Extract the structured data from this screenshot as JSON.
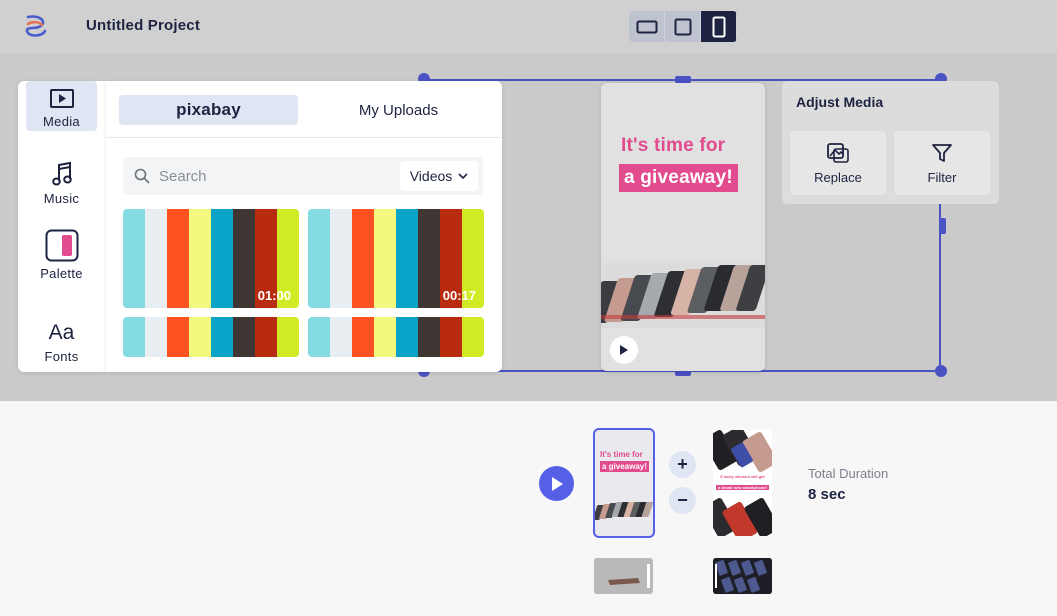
{
  "header": {
    "project_title": "Untitled Project",
    "aspect_options": [
      {
        "name": "landscape",
        "active": false
      },
      {
        "name": "square",
        "active": false
      },
      {
        "name": "portrait",
        "active": true
      }
    ]
  },
  "sidebar": {
    "items": [
      {
        "label": "Media",
        "icon": "media-icon",
        "active": true
      },
      {
        "label": "Music",
        "icon": "music-icon",
        "active": false
      },
      {
        "label": "Palette",
        "icon": "palette-icon",
        "active": false
      },
      {
        "label": "Fonts",
        "icon": "fonts-icon",
        "active": false
      }
    ]
  },
  "media_panel": {
    "tabs": {
      "pixabay": "pixabay",
      "uploads": "My Uploads"
    },
    "search": {
      "placeholder": "Search",
      "value": ""
    },
    "type_select": "Videos",
    "thumbnails": [
      {
        "duration": "01:00"
      },
      {
        "duration": "00:17"
      },
      {
        "duration": ""
      },
      {
        "duration": ""
      }
    ],
    "bar_colors": [
      "#85dbe4",
      "#e8eef2",
      "#fe5222",
      "#f3f97f",
      "#0ba4c9",
      "#3f3634",
      "#b82b0e",
      "#d1ea26"
    ]
  },
  "canvas": {
    "story_line1": "It's time for",
    "story_line2": "a giveaway!",
    "accent": "#e24b8d",
    "selection_color": "#4a52c4"
  },
  "adjust_media": {
    "title": "Adjust Media",
    "replace_label": "Replace",
    "filter_label": "Filter"
  },
  "timeline": {
    "slide1_line1": "It's time for",
    "slide1_line2": "a giveaway!",
    "slide2_text1": "5 lucky winners will get",
    "slide2_text2": "a brand new smartphone!",
    "zoom_in": "+",
    "zoom_out": "−",
    "total_duration_label": "Total Duration",
    "total_duration_value": "8 sec",
    "play_color": "#5560e6"
  }
}
